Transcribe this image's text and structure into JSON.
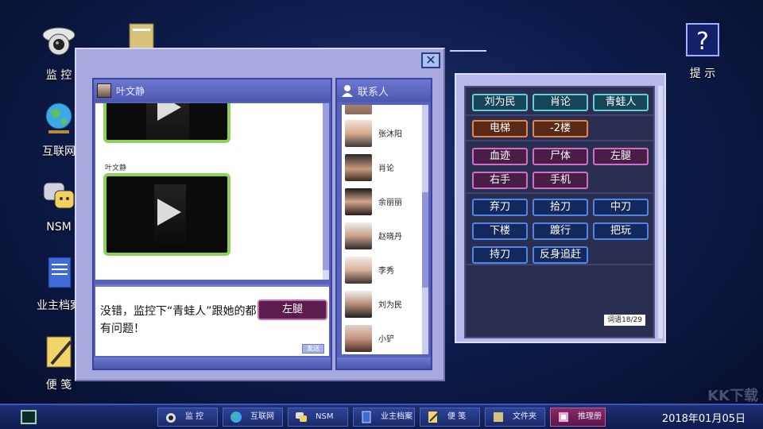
{
  "desktop": {
    "icons": [
      {
        "label": "监 控"
      },
      {
        "label": "互联网"
      },
      {
        "label": "NSM"
      },
      {
        "label": "业主档案"
      },
      {
        "label": "便 笺"
      }
    ],
    "help_label": "提 示"
  },
  "chat": {
    "close_glyph": "✕",
    "contact_name": "叶文静",
    "sender_label": "叶文静",
    "input_text": "没错，监控下“青蛙人”跟她的都有问题！",
    "input_chip": "左腿",
    "send_label": "发送"
  },
  "contacts": {
    "header": "联系人",
    "items": [
      {
        "name": ""
      },
      {
        "name": "张沐阳"
      },
      {
        "name": "肖论"
      },
      {
        "name": "余丽丽"
      },
      {
        "name": "赵晓丹"
      },
      {
        "name": "李秀"
      },
      {
        "name": "刘为民"
      },
      {
        "name": "小铲"
      }
    ]
  },
  "words": {
    "rows": [
      [
        "刘为民",
        "肖论",
        "青蛙人"
      ],
      [
        "电梯",
        "-2楼"
      ],
      [
        "血迹",
        "尸体",
        "左腿",
        "右手",
        "手机"
      ],
      [
        "弃刀",
        "拾刀",
        "中刀",
        "下楼",
        "踱行",
        "把玩",
        "持刀",
        "反身追赶"
      ]
    ],
    "count": "词语18/29"
  },
  "taskbar": {
    "items": [
      {
        "label": "监 控"
      },
      {
        "label": "互联网"
      },
      {
        "label": "NSM"
      },
      {
        "label": "业主档案"
      },
      {
        "label": "便 笺"
      },
      {
        "label": "文件夹"
      },
      {
        "label": "推理册"
      }
    ],
    "clock": "2018年01月05日"
  },
  "watermark": "KK下载"
}
